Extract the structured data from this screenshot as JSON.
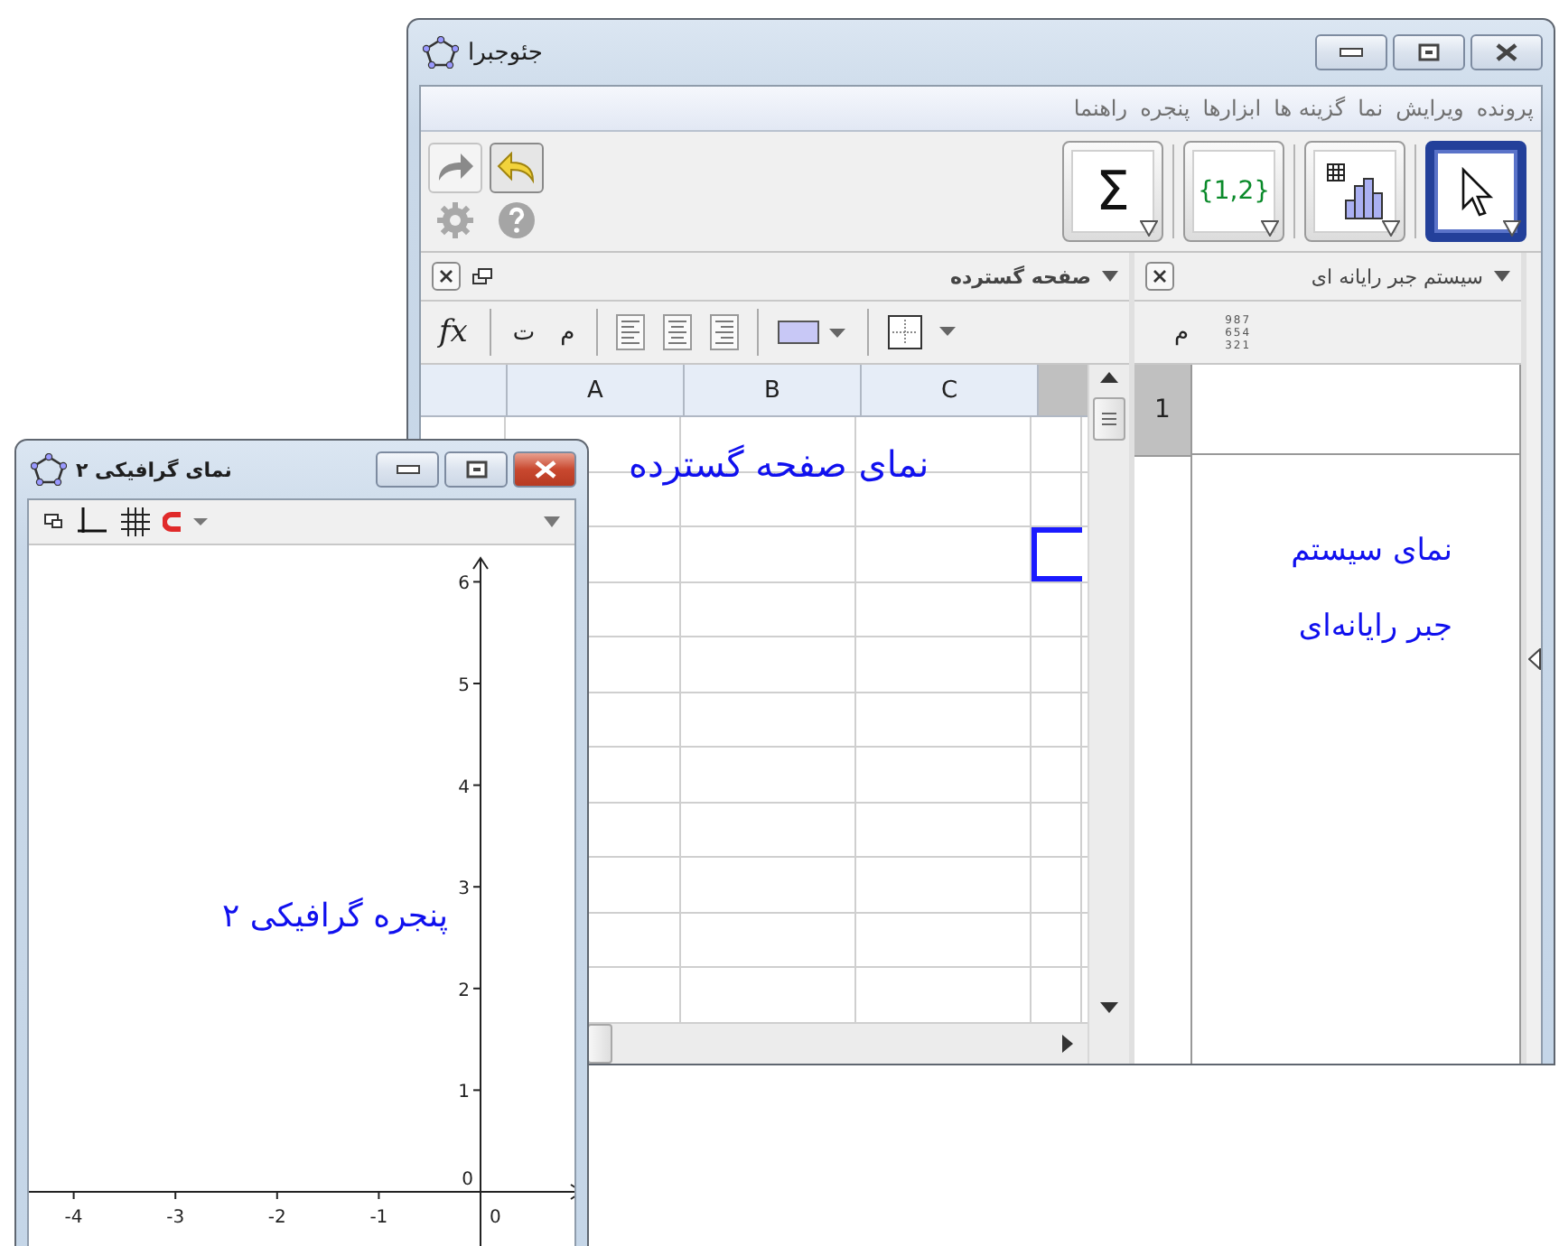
{
  "main_window": {
    "title": "جئوجبرا",
    "menu": [
      "پرونده",
      "ویرایش",
      "نما",
      "گزینه ها",
      "ابزارها",
      "پنجره",
      "راهنما"
    ],
    "tools": [
      {
        "kind": "pointer",
        "selected": true
      },
      {
        "kind": "chart",
        "selected": false
      },
      {
        "kind": "list",
        "label": "{1,2}",
        "selected": false
      },
      {
        "kind": "sum",
        "label": "Σ",
        "selected": false
      }
    ],
    "spreadsheet": {
      "title": "صفحه گسترده",
      "formula": "fx",
      "bold": "ت",
      "italic": "م",
      "columns": [
        "C",
        "B",
        "A"
      ],
      "overlay": "نمای صفحه گسترده"
    },
    "cas": {
      "title": "سیستم جبر رایانه ای",
      "italic": "م",
      "keypad": [
        "987",
        "654",
        "321"
      ],
      "rows": [
        {
          "number": "1"
        }
      ],
      "overlay": [
        "نمای سیستم",
        "جبر رایانه‌ای"
      ]
    }
  },
  "graphics_window": {
    "title": "نمای گرافیکی ۲",
    "x_ticks": [
      "-1",
      "-2",
      "-3",
      "-4"
    ],
    "y_ticks": [
      "6",
      "5",
      "4",
      "3",
      "2",
      "1"
    ],
    "y_origin": "0",
    "x_origin": "0",
    "overlay": "پنجره گرافیکی ۲"
  }
}
